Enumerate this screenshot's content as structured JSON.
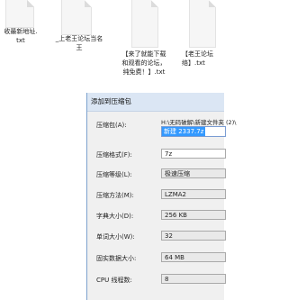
{
  "files": [
    {
      "name": "收最新地址.\ntxt"
    },
    {
      "name": "_上老王论坛当名\n王"
    },
    {
      "name": "【来了就能下载\n和观看的论坛，\n纯免费！】.txt"
    },
    {
      "name": "【老王论坛\n络】.txt"
    }
  ],
  "dialog": {
    "title": "添加到压缩包",
    "archive_label": "压缩包(A):",
    "archive_path": "H:\\无码破解\\新建文件夹 (2)\\",
    "archive_name": "新建 2337.7z",
    "format_label": "压缩格式(F):",
    "format_value": "7z",
    "level_label": "压缩等级(L):",
    "level_value": "极速压缩",
    "method_label": "压缩方法(M):",
    "method_value": "LZMA2",
    "dict_label": "字典大小(D):",
    "dict_value": "256 KB",
    "word_label": "单词大小(W):",
    "word_value": "32",
    "solid_label": "固实数据大小:",
    "solid_value": "64 MB",
    "threads_label": "CPU 线程数:",
    "threads_value": "8"
  }
}
